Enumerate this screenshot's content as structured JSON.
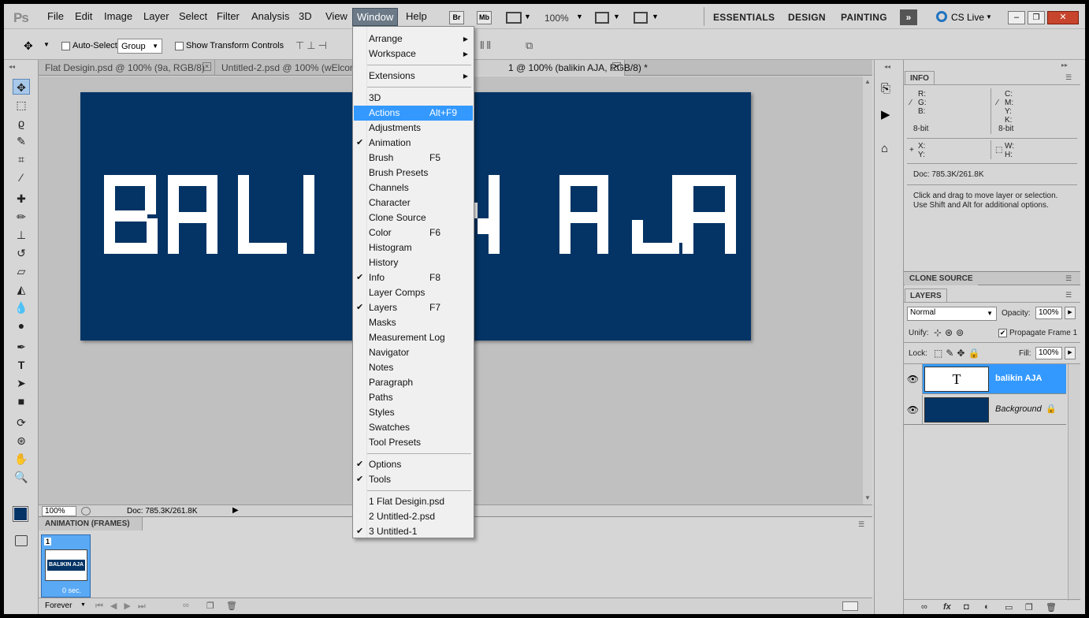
{
  "menubar": {
    "logo": "Ps",
    "items": [
      "File",
      "Edit",
      "Image",
      "Layer",
      "Select",
      "Filter",
      "Analysis",
      "3D",
      "View",
      "Window",
      "Help"
    ],
    "active": "Window",
    "bridge": "Br",
    "mini_bridge": "Mb",
    "zoom": "100%",
    "workspaces": [
      "ESSENTIALS",
      "DESIGN",
      "PAINTING"
    ],
    "cs_live": "CS Live"
  },
  "options": {
    "auto_select_label": "Auto-Select:",
    "auto_select_value": "Group",
    "transform_label": "Show Transform Controls"
  },
  "tabs": [
    {
      "label": "Flat Desigin.psd @ 100% (9a, RGB/8)"
    },
    {
      "label": "Untitled-2.psd @ 100% (wElcom"
    },
    {
      "label": "1 @ 100% (balikin AJA, RGB/8) *"
    }
  ],
  "document": {
    "text": "BALIKIN AJA",
    "bg_color": "#043465"
  },
  "status": {
    "zoom": "100%",
    "doc": "Doc: 785.3K/261.8K"
  },
  "animation": {
    "title": "ANIMATION (FRAMES)",
    "frame_number": "1",
    "frame_thumb_text": "BALIKIN AJA",
    "frame_delay": "0 sec.",
    "loop": "Forever"
  },
  "info_panel": {
    "title": "INFO",
    "rgb_labels": [
      "R:",
      "G:",
      "B:"
    ],
    "cmyk_labels": [
      "C:",
      "M:",
      "Y:",
      "K:"
    ],
    "bit_left": "8-bit",
    "bit_right": "8-bit",
    "xy_labels": [
      "X:",
      "Y:"
    ],
    "wh_labels": [
      "W:",
      "H:"
    ],
    "doc": "Doc: 785.3K/261.8K",
    "hint1": "Click and drag to move layer or selection.",
    "hint2": "Use Shift and Alt for additional options."
  },
  "clone_source": {
    "title": "CLONE SOURCE"
  },
  "layers_panel": {
    "title": "LAYERS",
    "blend_mode": "Normal",
    "opacity_label": "Opacity:",
    "opacity": "100%",
    "unify_label": "Unify:",
    "propagate_label": "Propagate Frame 1",
    "lock_label": "Lock:",
    "fill_label": "Fill:",
    "fill": "100%",
    "layers": [
      {
        "name": "balikin AJA",
        "selected": true,
        "thumb": "T"
      },
      {
        "name": "Background",
        "selected": false,
        "thumb": ""
      }
    ]
  },
  "window_menu": {
    "items": [
      {
        "label": "Arrange",
        "submenu": true
      },
      {
        "label": "Workspace",
        "submenu": true
      },
      {
        "sep": true
      },
      {
        "label": "Extensions",
        "submenu": true
      },
      {
        "sep": true
      },
      {
        "label": "3D"
      },
      {
        "label": "Actions",
        "shortcut": "Alt+F9",
        "highlight": true
      },
      {
        "label": "Adjustments"
      },
      {
        "label": "Animation",
        "checked": true
      },
      {
        "label": "Brush",
        "shortcut": "F5"
      },
      {
        "label": "Brush Presets"
      },
      {
        "label": "Channels"
      },
      {
        "label": "Character"
      },
      {
        "label": "Clone Source"
      },
      {
        "label": "Color",
        "shortcut": "F6"
      },
      {
        "label": "Histogram"
      },
      {
        "label": "History"
      },
      {
        "label": "Info",
        "shortcut": "F8",
        "checked": true
      },
      {
        "label": "Layer Comps"
      },
      {
        "label": "Layers",
        "shortcut": "F7",
        "checked": true
      },
      {
        "label": "Masks"
      },
      {
        "label": "Measurement Log"
      },
      {
        "label": "Navigator"
      },
      {
        "label": "Notes"
      },
      {
        "label": "Paragraph"
      },
      {
        "label": "Paths"
      },
      {
        "label": "Styles"
      },
      {
        "label": "Swatches"
      },
      {
        "label": "Tool Presets"
      },
      {
        "sep": true
      },
      {
        "label": "Options",
        "checked": true
      },
      {
        "label": "Tools",
        "checked": true
      },
      {
        "sep": true
      },
      {
        "label": "1 Flat Desigin.psd"
      },
      {
        "label": "2 Untitled-2.psd"
      },
      {
        "label": "3 Untitled-1",
        "checked": true
      }
    ]
  },
  "colors": {
    "highlight": "#3399ff",
    "doc_bg": "#043465",
    "layer_selected": "#3399ff"
  }
}
